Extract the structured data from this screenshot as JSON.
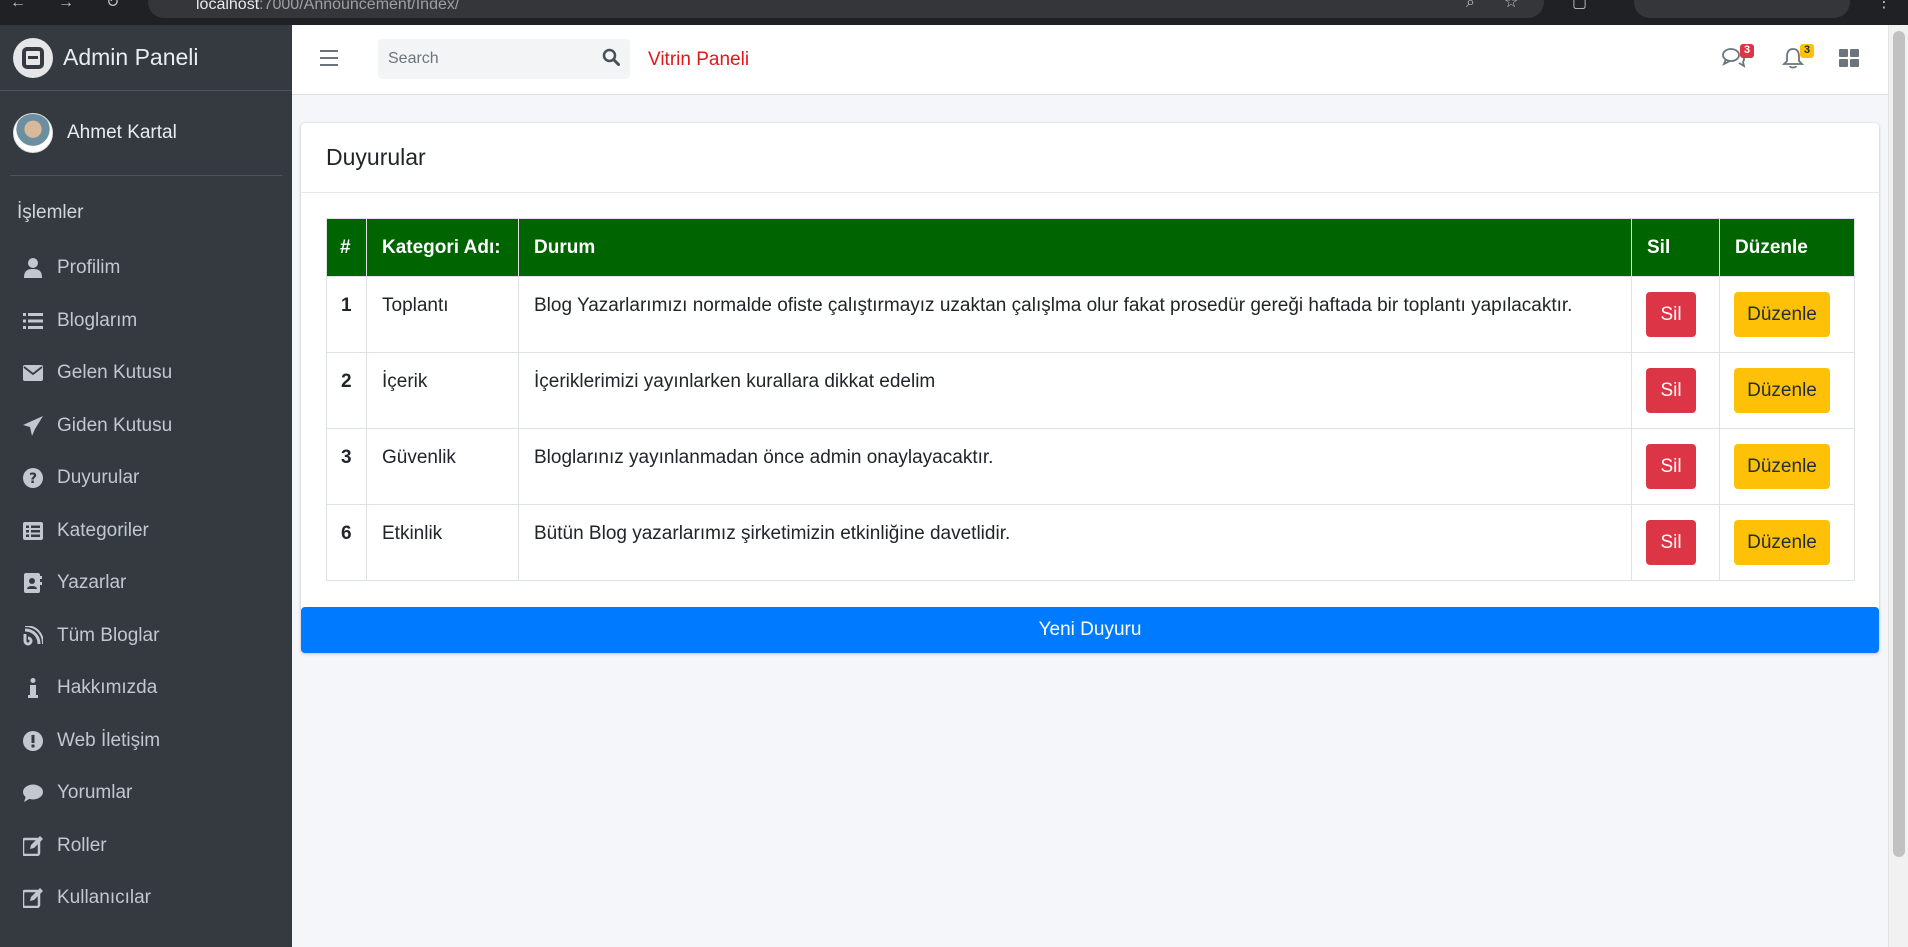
{
  "browser": {
    "url_host": "localhost",
    "url_path": ":7000/Announcement/Index/"
  },
  "sidebar": {
    "brand": "Admin Paneli",
    "user_name": "Ahmet Kartal",
    "section_header": "İşlemler",
    "items": [
      {
        "label": "Profilim",
        "icon": "user-icon"
      },
      {
        "label": "Bloglarım",
        "icon": "list-icon"
      },
      {
        "label": "Gelen Kutusu",
        "icon": "envelope-icon"
      },
      {
        "label": "Giden Kutusu",
        "icon": "paper-plane-icon"
      },
      {
        "label": "Duyurular",
        "icon": "question-circle-icon"
      },
      {
        "label": "Kategoriler",
        "icon": "list-alt-icon"
      },
      {
        "label": "Yazarlar",
        "icon": "address-book-icon"
      },
      {
        "label": "Tüm Bloglar",
        "icon": "blog-icon"
      },
      {
        "label": "Hakkımızda",
        "icon": "info-icon"
      },
      {
        "label": "Web İletişim",
        "icon": "exclamation-circle-icon"
      },
      {
        "label": "Yorumlar",
        "icon": "comment-icon"
      },
      {
        "label": "Roller",
        "icon": "edit-icon"
      },
      {
        "label": "Kullanıcılar",
        "icon": "edit-icon"
      }
    ]
  },
  "topbar": {
    "search_placeholder": "Search",
    "vitrin_link": "Vitrin Paneli",
    "messages_count": "3",
    "notifications_count": "3"
  },
  "card": {
    "title": "Duyurular",
    "columns": [
      "#",
      "Kategori Adı:",
      "Durum",
      "Sil",
      "Düzenle"
    ],
    "rows": [
      {
        "id": "1",
        "category": "Toplantı",
        "status": "Blog Yazarlarımızı normalde ofiste çalıştırmayız uzaktan çalışlma olur fakat prosedür gereği haftada bir toplantı yapılacaktır.",
        "delete_label": "Sil",
        "edit_label": "Düzenle"
      },
      {
        "id": "2",
        "category": "İçerik",
        "status": "İçeriklerimizi yayınlarken kurallara dikkat edelim",
        "delete_label": "Sil",
        "edit_label": "Düzenle"
      },
      {
        "id": "3",
        "category": "Güvenlik",
        "status": "Bloglarınız yayınlanmadan önce admin onaylayacaktır.",
        "delete_label": "Sil",
        "edit_label": "Düzenle"
      },
      {
        "id": "6",
        "category": "Etkinlik",
        "status": "Bütün Blog yazarlarımız şirketimizin etkinliğine davetlidir.",
        "delete_label": "Sil",
        "edit_label": "Düzenle"
      }
    ],
    "new_button": "Yeni Duyuru"
  },
  "colors": {
    "sidebar_bg": "#343a40",
    "table_header_bg": "#006400",
    "delete_btn": "#dc3545",
    "edit_btn": "#ffc107",
    "new_btn": "#007bff",
    "vitrin_link": "#e01818"
  }
}
